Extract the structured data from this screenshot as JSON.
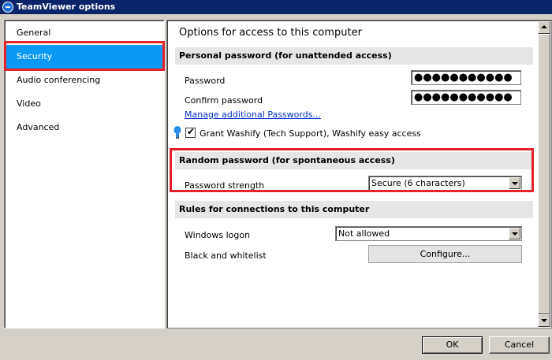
{
  "window": {
    "title": "TeamViewer options"
  },
  "sidebar": {
    "items": [
      {
        "label": "General"
      },
      {
        "label": "Security"
      },
      {
        "label": "Audio conferencing"
      },
      {
        "label": "Video"
      },
      {
        "label": "Advanced"
      }
    ]
  },
  "main": {
    "heading": "Options for access to this computer",
    "personal": {
      "header": "Personal password (for unattended access)",
      "password_label": "Password",
      "password_value": "●●●●●●●●●●●",
      "confirm_label": "Confirm password",
      "confirm_value": "●●●●●●●●●●●",
      "manage_link": "Manage additional Passwords...",
      "grant_label": "Grant Washify (Tech Support), Washify easy access"
    },
    "random": {
      "header": "Random password (for spontaneous access)",
      "strength_label": "Password strength",
      "strength_value": "Secure (6 characters)"
    },
    "rules": {
      "header": "Rules for connections to this computer",
      "windows_logon_label": "Windows logon",
      "windows_logon_value": "Not allowed",
      "blackwhite_label": "Black and whitelist",
      "configure_button": "Configure..."
    }
  },
  "footer": {
    "ok_label": "OK",
    "cancel_label": "Cancel"
  },
  "colors": {
    "selection": "#0b99f5",
    "highlight": "#e5222a",
    "titlebar": "#0a246a"
  }
}
